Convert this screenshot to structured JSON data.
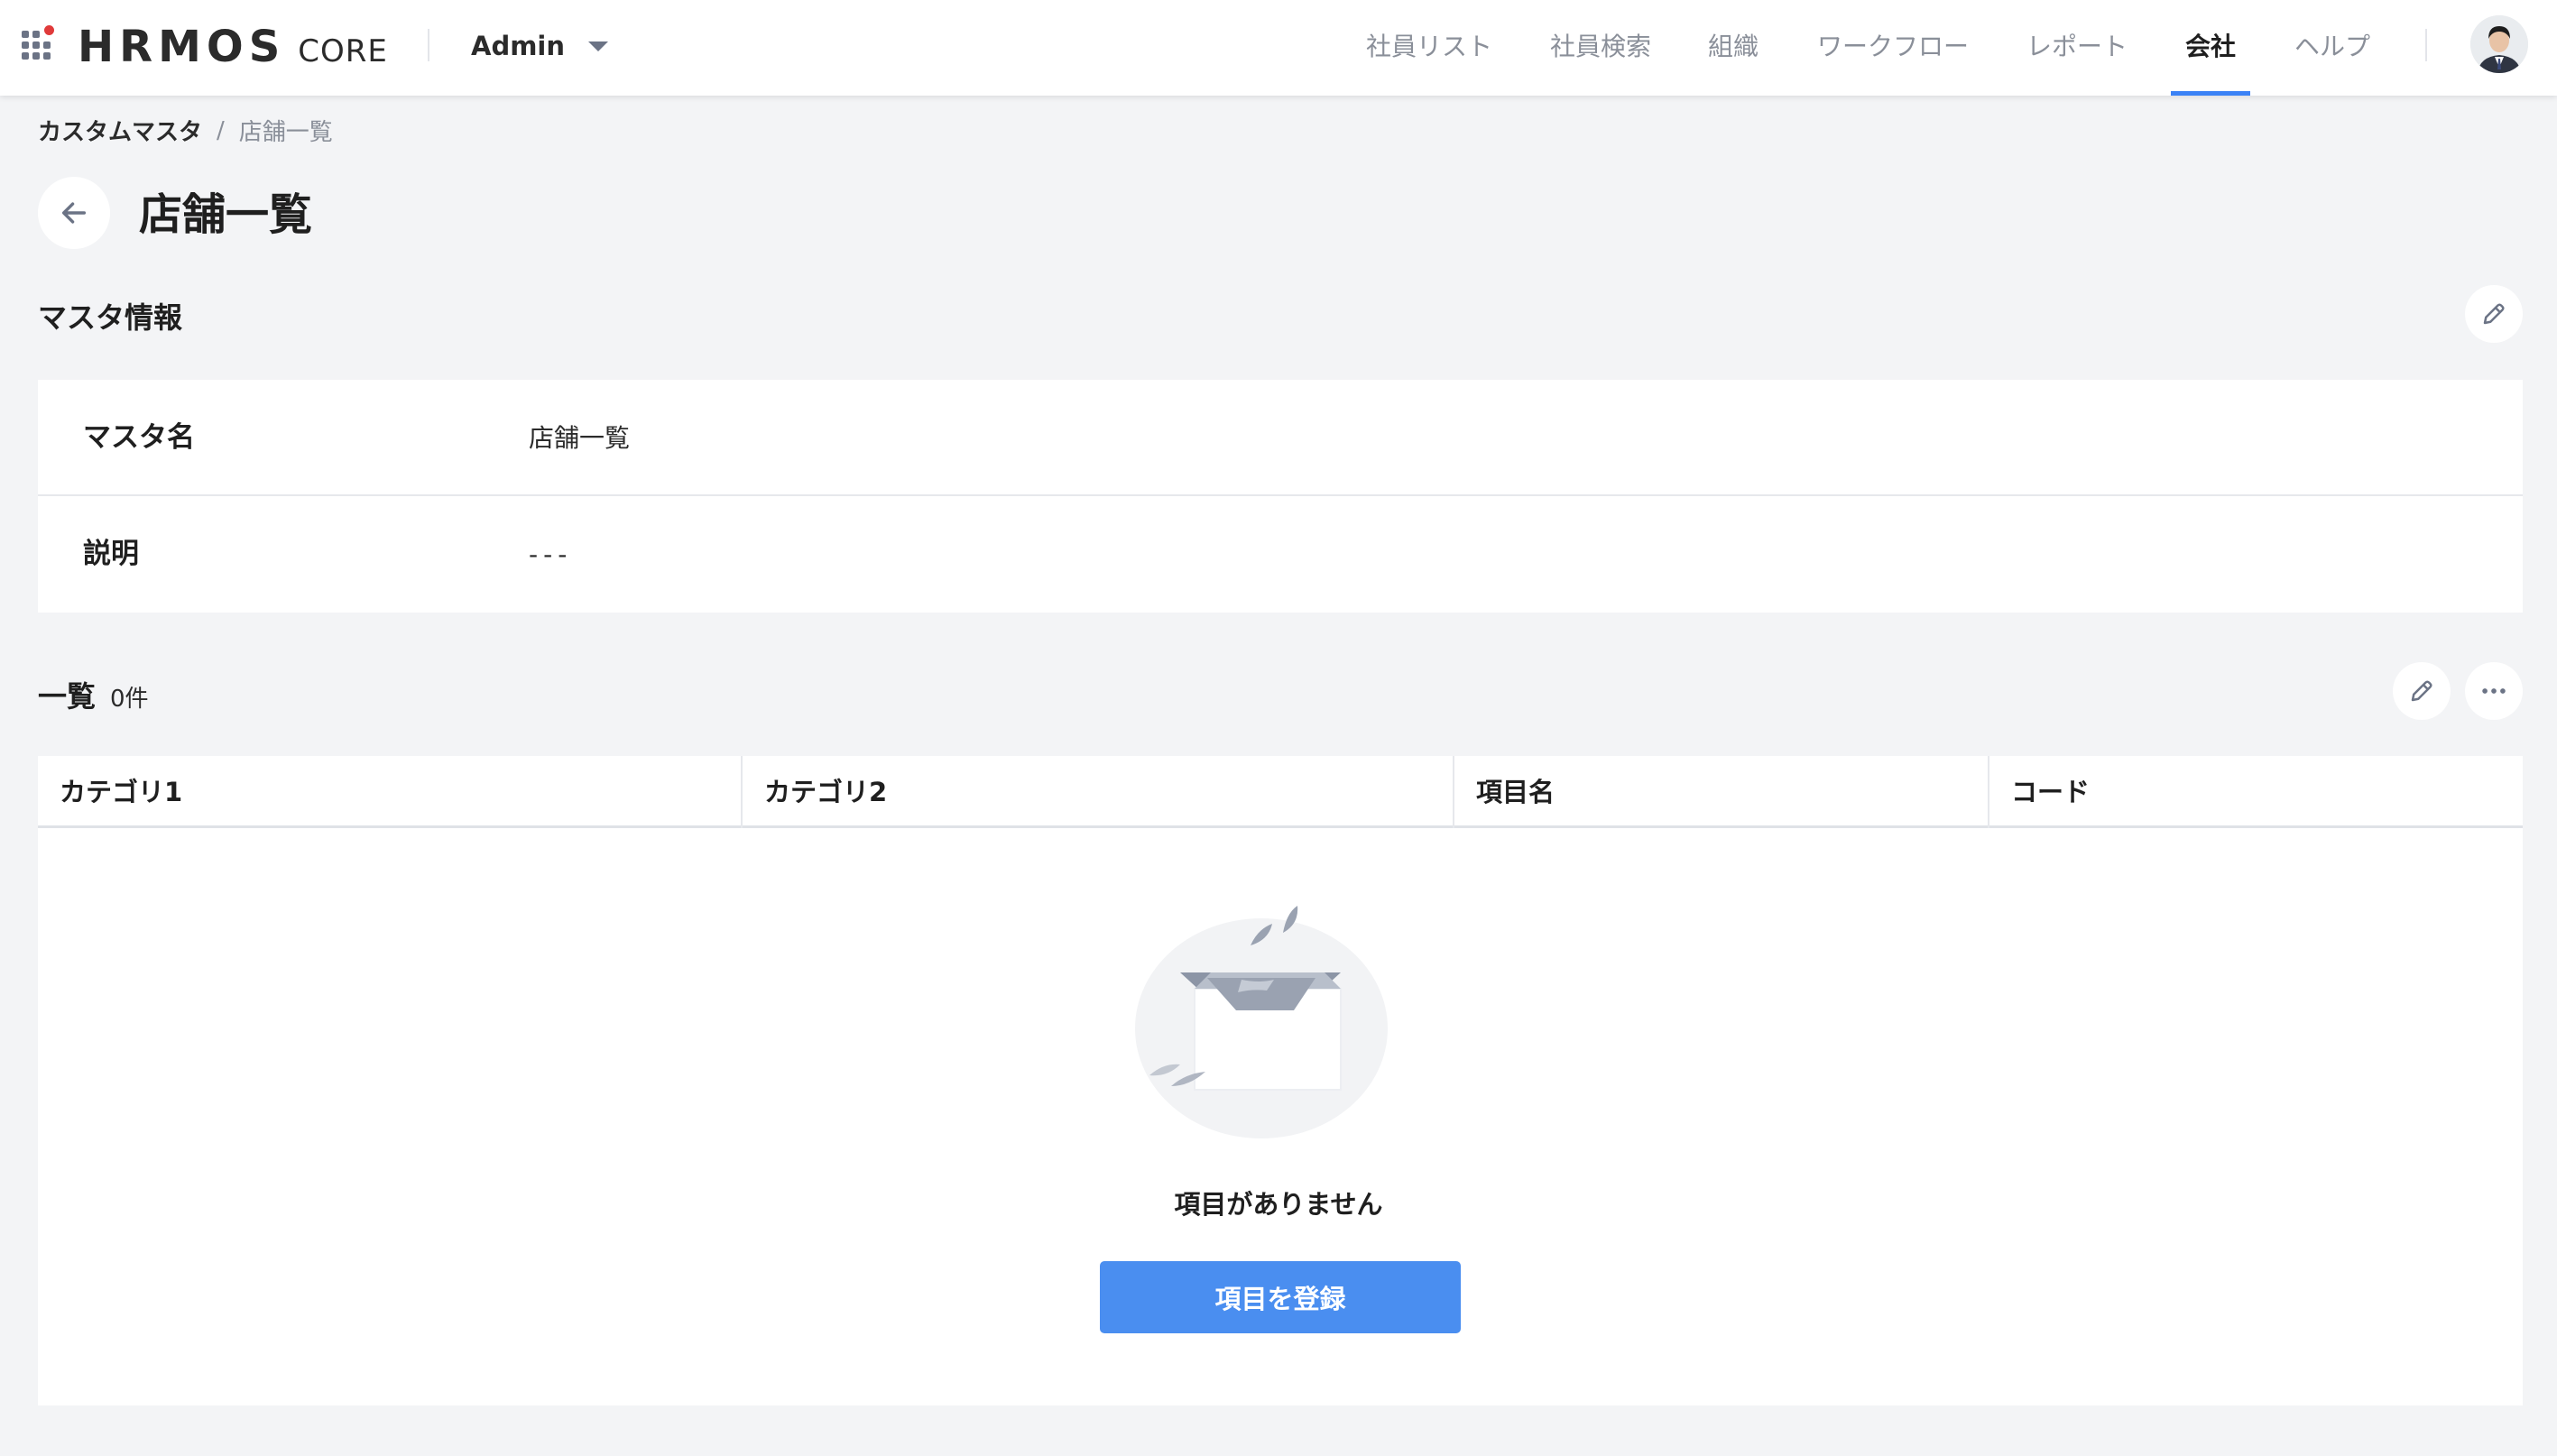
{
  "app": {
    "logo_text": "HRMOS",
    "logo_sub": "CORE",
    "role_label": "Admin",
    "avatar_icon": "user-avatar"
  },
  "nav": {
    "items": [
      {
        "label": "社員リスト"
      },
      {
        "label": "社員検索"
      },
      {
        "label": "組織"
      },
      {
        "label": "ワークフロー"
      },
      {
        "label": "レポート"
      },
      {
        "label": "会社",
        "active": true
      },
      {
        "label": "ヘルプ"
      }
    ]
  },
  "breadcrumb": {
    "parent": "カスタムマスタ",
    "separator": "/",
    "current": "店舗一覧"
  },
  "page": {
    "title": "店舗一覧"
  },
  "master_info": {
    "heading": "マスタ情報",
    "rows": [
      {
        "label": "マスタ名",
        "value": "店舗一覧"
      },
      {
        "label": "説明",
        "value": "---"
      }
    ]
  },
  "list": {
    "heading": "一覧",
    "count": "0件",
    "columns": [
      "カテゴリ1",
      "カテゴリ2",
      "項目名",
      "コード"
    ],
    "empty_message": "項目がありません",
    "register_label": "項目を登録"
  },
  "colors": {
    "accent": "#3b82f6",
    "button": "#4a8ef0",
    "logo_dot": "#e03a3a",
    "background": "#f3f4f6"
  }
}
